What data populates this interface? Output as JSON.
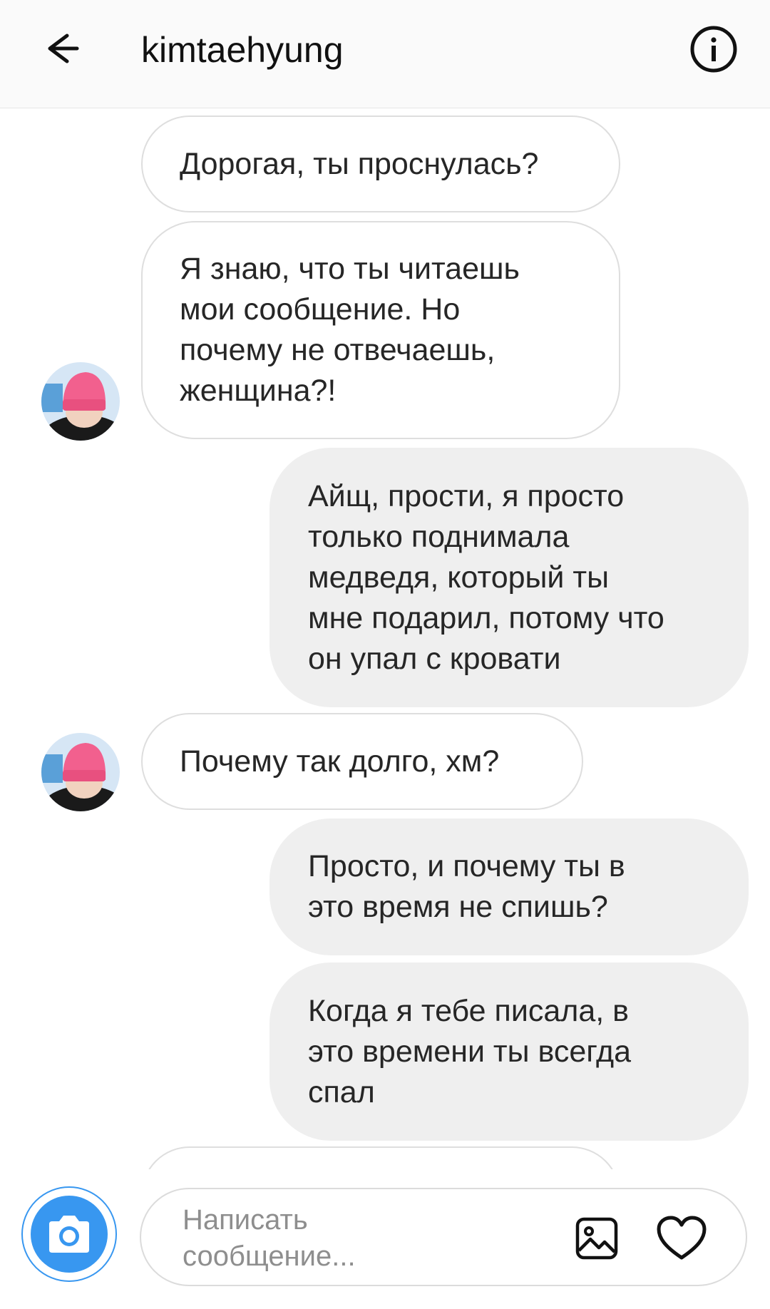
{
  "header": {
    "title": "kimtaehyung",
    "back_icon": "arrow-left-icon",
    "info_icon": "info-circle-icon"
  },
  "messages": [
    {
      "direction": "incoming",
      "text": "Дорогая, ты проснулась?"
    },
    {
      "direction": "incoming",
      "text": "Я знаю, что ты читаешь\nмои сообщение. Но\nпочему не отвечаешь,\nженщина?!"
    },
    {
      "direction": "outgoing",
      "text": "Айщ, прости, я просто\nтолько поднимала\nмедведя, который ты\nмне подарил, потому что\nон упал с кровати"
    },
    {
      "direction": "incoming",
      "text": "Почему так долго, хм?"
    },
    {
      "direction": "outgoing",
      "text": "Просто, и почему ты в\nэто время не спишь?"
    },
    {
      "direction": "outgoing",
      "text": "Когда я тебе писала, в\nэто времени ты всегда\nспал"
    },
    {
      "direction": "incoming",
      "text": ""
    }
  ],
  "composer": {
    "placeholder": "Написать\nсообщение...",
    "camera_icon": "camera-icon",
    "gallery_icon": "image-gallery-icon",
    "heart_icon": "heart-icon"
  },
  "colors": {
    "accent": "#3897f0",
    "outgoing_bubble": "#efefef",
    "incoming_border": "#dedede",
    "text": "#262626",
    "placeholder": "#8e8e8e"
  }
}
